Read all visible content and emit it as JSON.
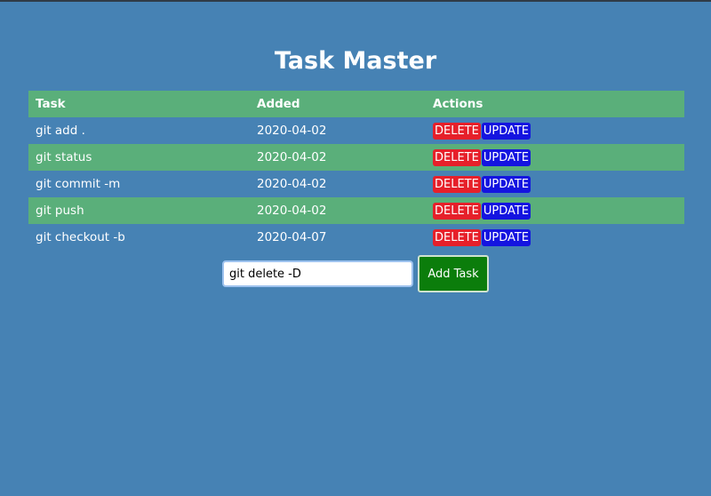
{
  "app": {
    "title": "Task Master"
  },
  "table": {
    "headers": {
      "task": "Task",
      "added": "Added",
      "actions": "Actions"
    },
    "rows": [
      {
        "task": "git add .",
        "added": "2020-04-02",
        "delete_label": "DELETE",
        "update_label": "UPDATE"
      },
      {
        "task": "git status",
        "added": "2020-04-02",
        "delete_label": "DELETE",
        "update_label": "UPDATE"
      },
      {
        "task": "git commit -m",
        "added": "2020-04-02",
        "delete_label": "DELETE",
        "update_label": "UPDATE"
      },
      {
        "task": "git push",
        "added": "2020-04-02",
        "delete_label": "DELETE",
        "update_label": "UPDATE"
      },
      {
        "task": "git checkout -b",
        "added": "2020-04-07",
        "delete_label": "DELETE",
        "update_label": "UPDATE"
      }
    ]
  },
  "form": {
    "input_value": "git delete -D",
    "submit_label": "Add Task"
  },
  "colors": {
    "background": "#4682b4",
    "stripe": "#5aaf7a",
    "delete": "#e6202a",
    "update": "#1414e0",
    "add_button": "#0b7d0b"
  }
}
